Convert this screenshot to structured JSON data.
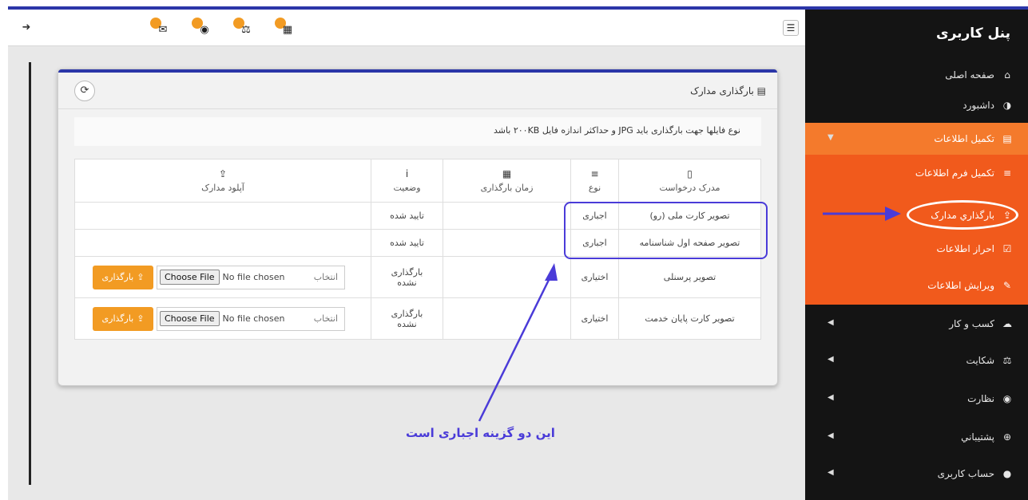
{
  "sidebar": {
    "title": "پنل کاربری",
    "items": [
      {
        "label": "صفحه اصلی"
      },
      {
        "label": "داشبورد"
      },
      {
        "label": "تکمیل اطلاعات"
      },
      {
        "label": "تکمیل فرم اطلاعات"
      },
      {
        "label": "بارگذاري مدارک"
      },
      {
        "label": "احراز اطلاعات"
      },
      {
        "label": "ویرایش اطلاعات"
      },
      {
        "label": "کسب و کار"
      },
      {
        "label": "شکایت"
      },
      {
        "label": "نظارت"
      },
      {
        "label": "پشتيباني"
      },
      {
        "label": "حساب کاربری"
      }
    ]
  },
  "topbar": {
    "icons": [
      "mail-icon",
      "support-icon",
      "scale-icon",
      "calendar-check-icon"
    ]
  },
  "panel": {
    "title": "بارگذاری مدارک",
    "notice": "نوع فایلها جهت بارگذاری باید JPG و حداکثر اندازه فایل ۲۰۰KB باشد"
  },
  "table": {
    "headers": {
      "document": "مدرک درخواست",
      "type": "نوع",
      "time": "زمان بارگذاری",
      "status": "وضعیت",
      "upload": "آپلود مدارک"
    },
    "rows": [
      {
        "document": "تصویر کارت ملی (رو)",
        "type": "اجباری",
        "time": "",
        "status": "تایید شده"
      },
      {
        "document": "تصویر صفحه اول شناسنامه",
        "type": "اجباری",
        "time": "",
        "status": "تایید شده"
      },
      {
        "document": "تصویر پرسنلی",
        "type": "اختیاری",
        "time": "",
        "status": "بارگذاری نشده"
      },
      {
        "document": "تصویر کارت پایان خدمت",
        "type": "اختیاری",
        "time": "",
        "status": "بارگذاری نشده"
      }
    ],
    "upload": {
      "button_label": "بارگذاری",
      "choose_file": "Choose File",
      "no_file": "No file chosen",
      "placeholder": "انتخاب"
    }
  },
  "annotation": {
    "text": "این دو گزینه اجباری است"
  },
  "colors": {
    "accent_orange": "#f15a1c",
    "button_orange": "#f29b23",
    "annotation_blue": "#4a3bd8",
    "frame_blue": "#2b36a8"
  }
}
